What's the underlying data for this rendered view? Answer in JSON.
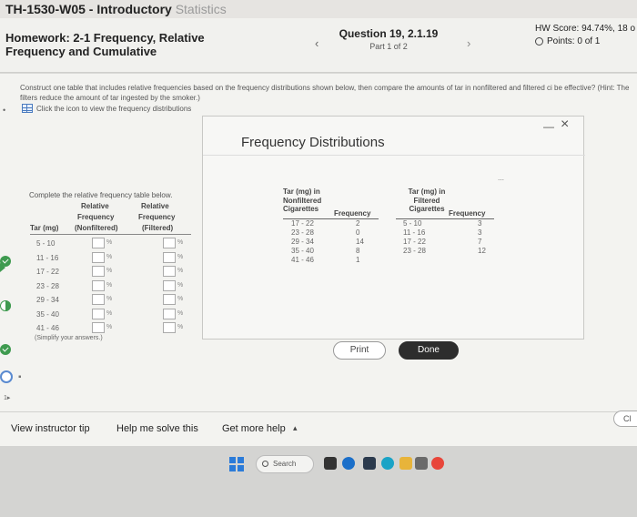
{
  "browser": {
    "title": "TH-1530-W05 - Introductory",
    "title_faded": " Statistics"
  },
  "header": {
    "homework_title": "Homework: 2-1 Frequency, Relative Frequency and Cumulative",
    "prev_icon": "chevron-left-icon",
    "next_icon": "chevron-right-icon",
    "question_title": "Question 19, 2.1.19",
    "question_part": "Part 1 of 2",
    "hw_score": "HW Score: 94.74%, 18 o",
    "points": "Points: 0 of 1"
  },
  "instructions": {
    "text": "Construct one table that includes relative frequencies based on the frequency distributions shown below, then compare the amounts of tar in nonfiltered and filtered ci be effective? (Hint: The filters reduce the amount of tar ingested by the smoker.)",
    "icon_text": "Click the icon to view the frequency distributions"
  },
  "completion": {
    "prompt": "Complete the relative frequency table below.",
    "head_relative_1": "Relative",
    "head_relative_2": "Relative",
    "head_frequency_1": "Frequency",
    "head_frequency_2": "Frequency",
    "head_tar": "Tar (mg)",
    "head_nonfiltered": "(Nonfiltered)",
    "head_filtered": "(Filtered)",
    "rows": [
      {
        "class": "5 - 10"
      },
      {
        "class": "11 - 16"
      },
      {
        "class": "17 - 22"
      },
      {
        "class": "23 - 28"
      },
      {
        "class": "29 - 34"
      },
      {
        "class": "35 - 40"
      },
      {
        "class": "41 - 46"
      }
    ],
    "percent_sign": "%",
    "simplify_note": "(Simplify your answers.)"
  },
  "modal": {
    "title": "Frequency Distributions",
    "minimize_icon": "minimize-icon",
    "close_glyph": "×",
    "nonfiltered": {
      "caption_line1": "Tar (mg) in",
      "caption_line2": "Nonfiltered",
      "caption_line3": "Cigarettes",
      "freq_label": "Frequency",
      "rows": [
        {
          "class": "17 - 22",
          "freq": "2"
        },
        {
          "class": "23 - 28",
          "freq": "0"
        },
        {
          "class": "29 - 34",
          "freq": "14"
        },
        {
          "class": "35 - 40",
          "freq": "8"
        },
        {
          "class": "41 - 46",
          "freq": "1"
        }
      ]
    },
    "filtered": {
      "caption_line1": "Tar (mg) in",
      "caption_line2": "Filtered",
      "caption_line3": "Cigarettes",
      "freq_label": "Frequency",
      "rows": [
        {
          "class": "5 - 10",
          "freq": "3"
        },
        {
          "class": "11 - 16",
          "freq": "3"
        },
        {
          "class": "17 - 22",
          "freq": "7"
        },
        {
          "class": "23 - 28",
          "freq": "12"
        }
      ]
    },
    "print_label": "Print",
    "done_label": "Done"
  },
  "footer": {
    "view_tip": "View instructor tip",
    "help_solve": "Help me solve this",
    "get_more_help": "Get more help",
    "more_help_chevron": "▴",
    "clear_label": "Cl"
  },
  "taskbar": {
    "search_label": "Search"
  },
  "colors": {
    "accent_green": "#3e9a4f",
    "accent_blue": "#2b7bd9",
    "done_button": "#2d2d2d"
  }
}
